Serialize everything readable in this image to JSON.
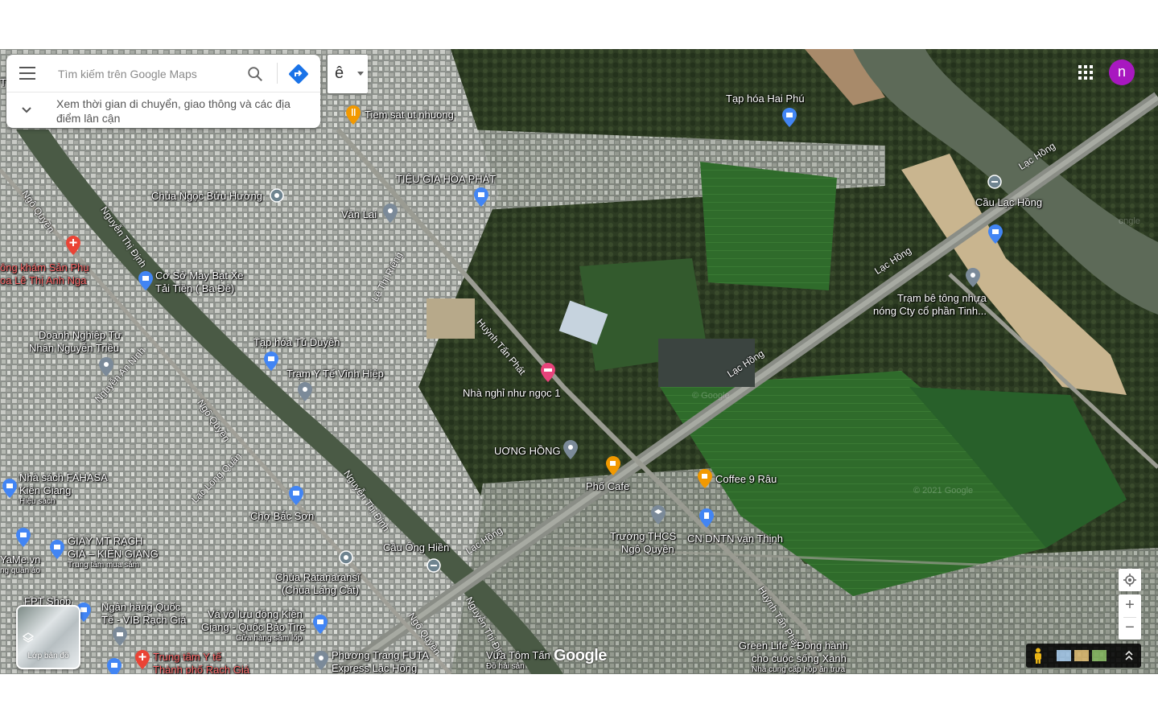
{
  "search": {
    "placeholder": "Tìm kiếm trên Google Maps",
    "hint": "Xem thời gian di chuyển, giao thông và các địa điểm lân cận"
  },
  "language_button": {
    "label": "ê"
  },
  "account": {
    "initial": "n",
    "color": "#a818c0"
  },
  "layers": {
    "label": "Lớp bản đồ"
  },
  "zoom": {
    "in_label": "+",
    "out_label": "−"
  },
  "branding": {
    "logo": "Google"
  },
  "watermarks": [
    "ongle",
    "© 2021 Google",
    "© Google"
  ],
  "places": [
    {
      "name": "Tiem sat ut nhuong",
      "icon": "restaurant-icon"
    },
    {
      "name": "Tạp hóa Hai Phú",
      "icon": "shopping-icon"
    },
    {
      "name": "TIỆU GIA HÒA PHÁT",
      "icon": "shopping-icon"
    },
    {
      "name": "Chùa Ngọc Bửu Hương",
      "icon": "temple-icon"
    },
    {
      "name": "Văn Lai",
      "icon": "pin-icon"
    },
    {
      "name": "Cầu Lạc Hồng",
      "icon": "bridge-icon"
    },
    {
      "name": "ông khám Sản Phụ",
      "icon": "hospital-icon"
    },
    {
      "name": "oa Lê Thị Anh Nga",
      "icon": "hospital-icon"
    },
    {
      "name": "Cơ Sở May Bạt Xe",
      "icon": "shopping-icon"
    },
    {
      "name": "Tải Tiền ( Ba Đê)",
      "icon": ""
    },
    {
      "name": "Trạm bê tông nhựa",
      "icon": "pin-icon"
    },
    {
      "name": "nóng Cty cổ phần Tinh...",
      "icon": ""
    },
    {
      "name": "Doanh Nghiệp Tư",
      "icon": "pin-icon"
    },
    {
      "name": "Nhân Nguyễn Triều",
      "icon": ""
    },
    {
      "name": "Tạp hóa Tú Duyên",
      "icon": "shopping-icon"
    },
    {
      "name": "Trạm Y Tế Vĩnh Hiệp",
      "icon": "pin-icon"
    },
    {
      "name": "Nhà nghỉ như ngọc 1",
      "icon": "hotel-icon"
    },
    {
      "name": "UƠNG HỒNG",
      "icon": "pin-icon"
    },
    {
      "name": "Phố Cafe",
      "icon": "cafe-icon"
    },
    {
      "name": "Coffee 9 Râu",
      "icon": "cafe-icon"
    },
    {
      "name": "Nhà sách FAHASA",
      "icon": "shopping-icon"
    },
    {
      "name": "Kiên Giang",
      "icon": ""
    },
    {
      "name": "Hiệu sách",
      "icon": ""
    },
    {
      "name": "Chợ Bắc Sơn",
      "icon": "shopping-icon"
    },
    {
      "name": "Trường THCS",
      "icon": "school-icon"
    },
    {
      "name": "Ngô Quyền",
      "icon": ""
    },
    {
      "name": "CN DNTN vạn Thịnh",
      "icon": "gas-icon"
    },
    {
      "name": "GIÀY MT RẠCH",
      "icon": "shopping-icon"
    },
    {
      "name": "GIÁ – KIÊN GIANG",
      "icon": ""
    },
    {
      "name": "Trung tâm mua sắm",
      "icon": ""
    },
    {
      "name": "YaMe.vn",
      "icon": "shopping-icon"
    },
    {
      "name": "ng quần áo",
      "icon": ""
    },
    {
      "name": "Cầu Ông Hiền",
      "icon": "bridge-icon"
    },
    {
      "name": "Chùa Ratanaransĩ",
      "icon": "temple-icon"
    },
    {
      "name": "(Chùa Láng Cát)",
      "icon": ""
    },
    {
      "name": "FPT Shop",
      "icon": "shopping-icon"
    },
    {
      "name": "Ngân hàng Quốc",
      "icon": "bank-icon"
    },
    {
      "name": "Tế - VIB Rạch Giá",
      "icon": ""
    },
    {
      "name": "Vá vỏ lưu động Kiên",
      "icon": "shopping-icon"
    },
    {
      "name": "Giang - Quốc Bảo Tire",
      "icon": ""
    },
    {
      "name": "Cửa hàng săm lốp",
      "icon": ""
    },
    {
      "name": "Trung tâm Y tế",
      "icon": "hospital-icon"
    },
    {
      "name": "Thành phố Rạch Giá",
      "icon": ""
    },
    {
      "name": "Phương Trang FUTA",
      "icon": "pin-icon"
    },
    {
      "name": "Express Lạc Hồng",
      "icon": ""
    },
    {
      "name": "Vựa Tôm Tấn",
      "icon": "pin-icon"
    },
    {
      "name": "Đồ hải sản",
      "icon": ""
    },
    {
      "name": "Green Life - Đồng hành",
      "icon": "pin-icon"
    },
    {
      "name": "cho cuộc sống Xanh",
      "icon": ""
    },
    {
      "name": "Nhà cung cấp hộp ăn trưa",
      "icon": ""
    },
    {
      "name": "T",
      "icon": ""
    }
  ],
  "roads": [
    "Lạc Hồng",
    "Lạc Hồng",
    "Lạc Hồng",
    "Lạc Hồng",
    "Ngô Quyền",
    "Ngô Quyền",
    "Ngô Quyền",
    "Nguyễn Thị Định",
    "Nguyễn Thị Định",
    "Nguyễn Thị Định",
    "Huỳnh Tấn Phát",
    "Huỳnh Tấn Phát",
    "Lê Thị Riêng",
    "Nguyễn An Ninh",
    "Lạc Long Quân"
  ]
}
